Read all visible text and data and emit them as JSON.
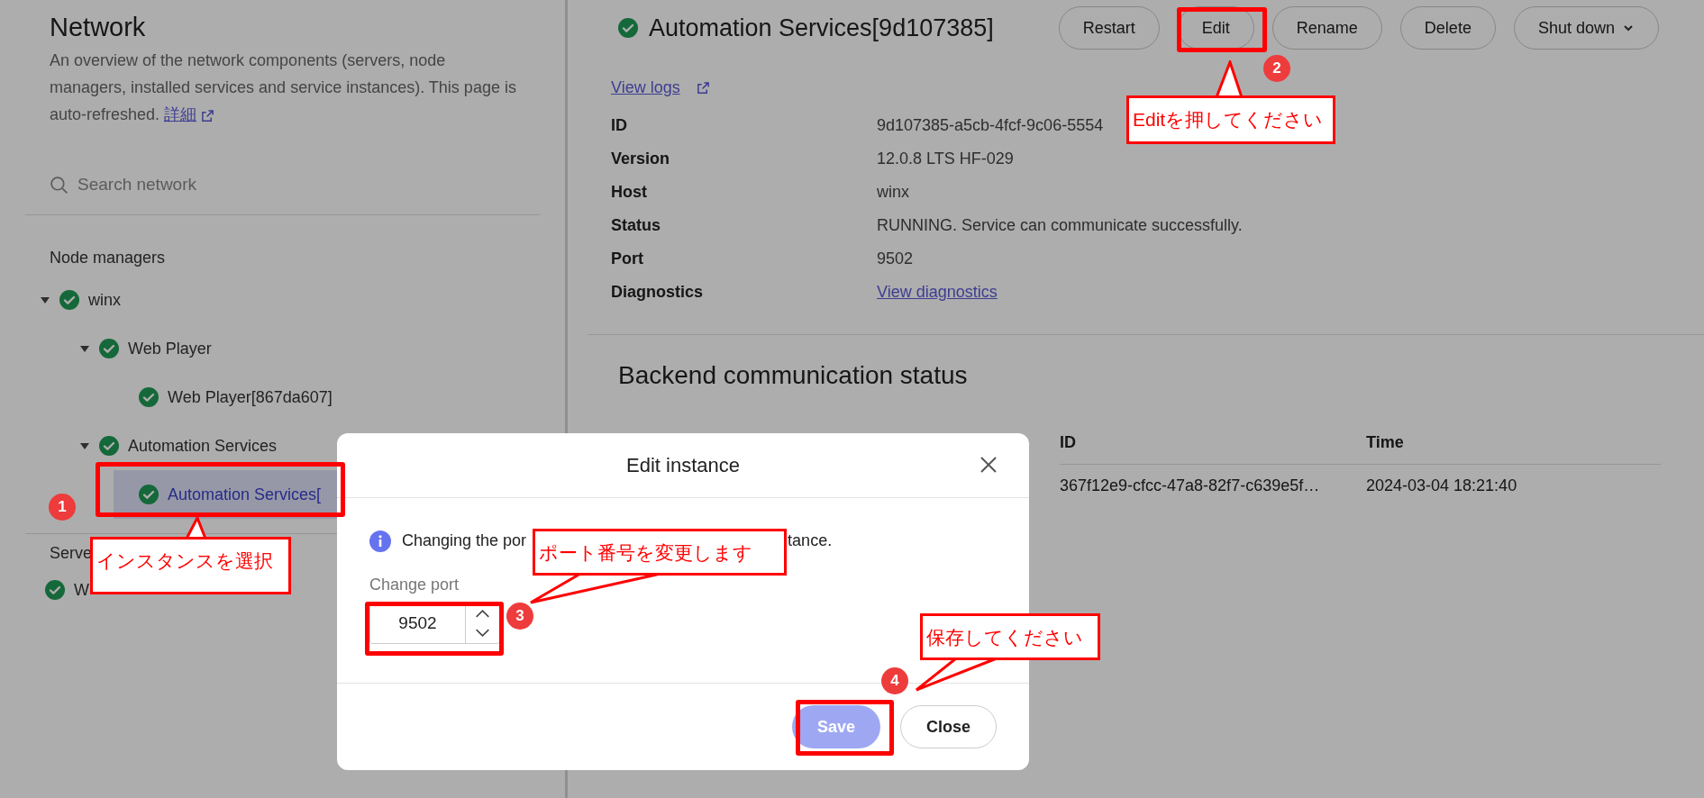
{
  "sidebar": {
    "title": "Network",
    "description": "An overview of the network components (servers, node managers, installed services and service instances). This page is auto-refreshed.",
    "link": "詳細",
    "search": {
      "placeholder": "Search network"
    },
    "sections": [
      {
        "heading": "Node managers",
        "items": [
          {
            "label": "winx",
            "expanded": true,
            "selected": false,
            "children": [
              {
                "label": "Web Player",
                "expanded": true,
                "selected": false,
                "children": [
                  {
                    "label": "Web Player[867da607]",
                    "selected": false
                  }
                ]
              },
              {
                "label": "Automation Services",
                "expanded": true,
                "selected": false,
                "children": [
                  {
                    "label": "Automation Services[",
                    "selected": true
                  }
                ]
              }
            ]
          }
        ]
      },
      {
        "heading": "Serve",
        "items": [
          {
            "label": "W",
            "selected": false
          }
        ]
      }
    ]
  },
  "detail": {
    "title": "Automation Services[9d107385]",
    "actions": [
      {
        "label": "Restart",
        "kind": "button"
      },
      {
        "label": "Edit",
        "kind": "button"
      },
      {
        "label": "Rename",
        "kind": "button"
      },
      {
        "label": "Delete",
        "kind": "button"
      },
      {
        "label": "Shut down",
        "kind": "dropdown"
      }
    ],
    "logs_link": "View logs",
    "fields": [
      {
        "label": "ID",
        "value": "9d107385-a5cb-4fcf-9c06-5554",
        "kind": "text"
      },
      {
        "label": "Version",
        "value": "12.0.8 LTS HF-029",
        "kind": "text"
      },
      {
        "label": "Host",
        "value": "winx",
        "kind": "text"
      },
      {
        "label": "Status",
        "value": "RUNNING. Service can communicate successfully.",
        "kind": "text"
      },
      {
        "label": "Port",
        "value": "9502",
        "kind": "text"
      },
      {
        "label": "Diagnostics",
        "value": "View diagnostics",
        "kind": "link"
      }
    ]
  },
  "backend": {
    "title": "Backend communication status",
    "columns": [
      "ID",
      "Time"
    ],
    "rows": [
      [
        "367f12e9-cfcc-47a8-82f7-c639e5f…",
        "2024-03-04 18:21:40"
      ]
    ]
  },
  "dialog": {
    "title": "Edit instance",
    "info_parts": [
      "Changing the por",
      "tance."
    ],
    "field": {
      "label": "Change port",
      "value": "9502"
    },
    "buttons": [
      {
        "label": "Save",
        "disabled": true
      },
      {
        "label": "Close",
        "disabled": false
      }
    ]
  },
  "annotations": [
    {
      "step": "1",
      "text": "インスタンスを選択"
    },
    {
      "step": "2",
      "text": "Editを押してください"
    },
    {
      "step": "3",
      "text": "ポート番号を変更します"
    },
    {
      "step": "4",
      "text": "保存してください"
    }
  ]
}
